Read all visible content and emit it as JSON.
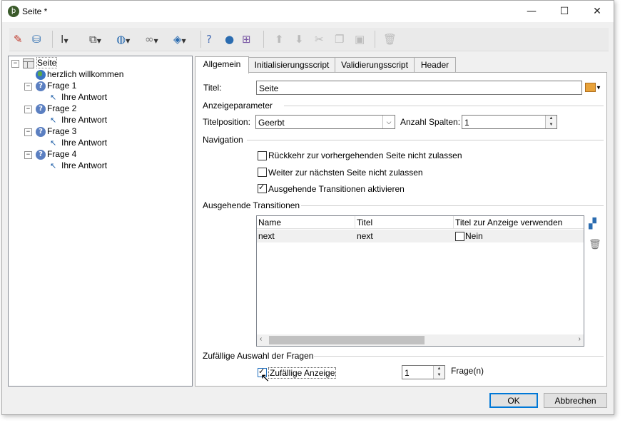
{
  "window": {
    "title": "Seite *",
    "app_icon": "ϸ",
    "minimize": "—",
    "maximize": "☐",
    "close": "✕"
  },
  "toolbar": {
    "icons": [
      "magic-wand-icon",
      "database-icon",
      "text-cursor-icon",
      "shapes-icon",
      "globe-icon",
      "link-icon",
      "box-icon",
      "help-icon",
      "user-icon",
      "add-component-icon",
      "move-up-icon",
      "move-down-icon",
      "cut-icon",
      "copy-icon",
      "paste-icon",
      "delete-icon"
    ]
  },
  "tree": {
    "root": "Seite",
    "welcome": "herzlich willkommen",
    "items": [
      {
        "question": "Frage 1",
        "answer": "Ihre Antwort"
      },
      {
        "question": "Frage 2",
        "answer": "Ihre Antwort"
      },
      {
        "question": "Frage 3",
        "answer": "Ihre Antwort"
      },
      {
        "question": "Frage 4",
        "answer": "Ihre Antwort"
      }
    ]
  },
  "tabs": [
    "Allgemein",
    "Initialisierungsscript",
    "Validierungsscript",
    "Header"
  ],
  "form": {
    "title_label": "Titel:",
    "title_value": "Seite",
    "display_params": "Anzeigeparameter",
    "title_position_label": "Titelposition:",
    "title_position_value": "Geerbt",
    "columns_label": "Anzahl Spalten:",
    "columns_value": "1",
    "navigation": "Navigation",
    "nav_no_back": "Rückkehr zur vorhergehenden Seite nicht zulassen",
    "nav_no_next": "Weiter zur nächsten Seite nicht zulassen",
    "nav_outgoing": "Ausgehende Transitionen aktivieren",
    "outgoing_section": "Ausgehende Transitionen",
    "grid_headers": [
      "Name",
      "Titel",
      "Titel zur Anzeige verwenden"
    ],
    "grid_row": {
      "name": "next",
      "title": "next",
      "use_title": "Nein"
    },
    "random_section": "Zufällige Auswahl der Fragen",
    "random_display": "Zufällige Anzeige",
    "random_count": "1",
    "random_unit": "Frage(n)"
  },
  "buttons": {
    "ok": "OK",
    "cancel": "Abbrechen"
  }
}
